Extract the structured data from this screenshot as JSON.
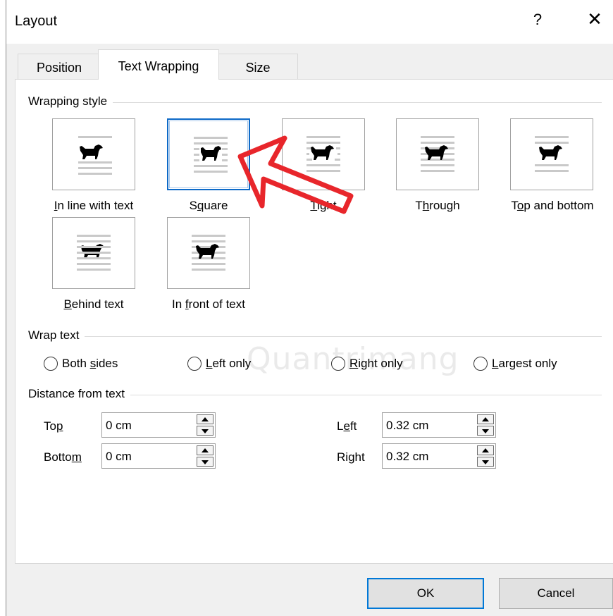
{
  "window": {
    "title": "Layout",
    "help": "?",
    "close": "✕"
  },
  "tabs": [
    {
      "label": "Position",
      "active": false
    },
    {
      "label": "Text Wrapping",
      "active": true
    },
    {
      "label": "Size",
      "active": false
    }
  ],
  "wrapping_style": {
    "label": "Wrapping style",
    "options": [
      {
        "pre": "",
        "key": "I",
        "post": "n line with text",
        "icon": "inline-wrap-icon",
        "selected": false
      },
      {
        "pre": "S",
        "key": "q",
        "post": "uare",
        "icon": "square-wrap-icon",
        "selected": true
      },
      {
        "pre": "",
        "key": "T",
        "post": "ight",
        "icon": "tight-wrap-icon",
        "selected": false
      },
      {
        "pre": "T",
        "key": "h",
        "post": "rough",
        "icon": "through-wrap-icon",
        "selected": false
      },
      {
        "pre": "T",
        "key": "o",
        "post": "p and bottom",
        "icon": "top-bottom-wrap-icon",
        "selected": false
      },
      {
        "pre": "",
        "key": "B",
        "post": "ehind text",
        "icon": "behind-text-wrap-icon",
        "selected": false
      },
      {
        "pre": "In ",
        "key": "f",
        "post": "ront of text",
        "icon": "in-front-wrap-icon",
        "selected": false
      }
    ]
  },
  "wrap_text": {
    "label": "Wrap text",
    "options": [
      {
        "pre": "Both ",
        "key": "s",
        "post": "ides"
      },
      {
        "pre": "",
        "key": "L",
        "post": "eft only"
      },
      {
        "pre": "",
        "key": "R",
        "post": "ight only"
      },
      {
        "pre": "",
        "key": "L",
        "post": "argest only"
      }
    ]
  },
  "distance": {
    "label": "Distance from text",
    "top": {
      "pre": "To",
      "key": "p",
      "post": "",
      "value": "0 cm"
    },
    "bottom": {
      "pre": "Botto",
      "key": "m",
      "post": "",
      "value": "0 cm"
    },
    "left": {
      "pre": "L",
      "key": "e",
      "post": "ft",
      "value": "0.32 cm"
    },
    "right": {
      "pre": "Ri",
      "key": "g",
      "post": "ht",
      "value": "0.32 cm"
    }
  },
  "buttons": {
    "ok": "OK",
    "cancel": "Cancel"
  },
  "watermark": "Quantrimang",
  "colors": {
    "accent": "#0078d7",
    "annotation_arrow": "#e8262b"
  }
}
